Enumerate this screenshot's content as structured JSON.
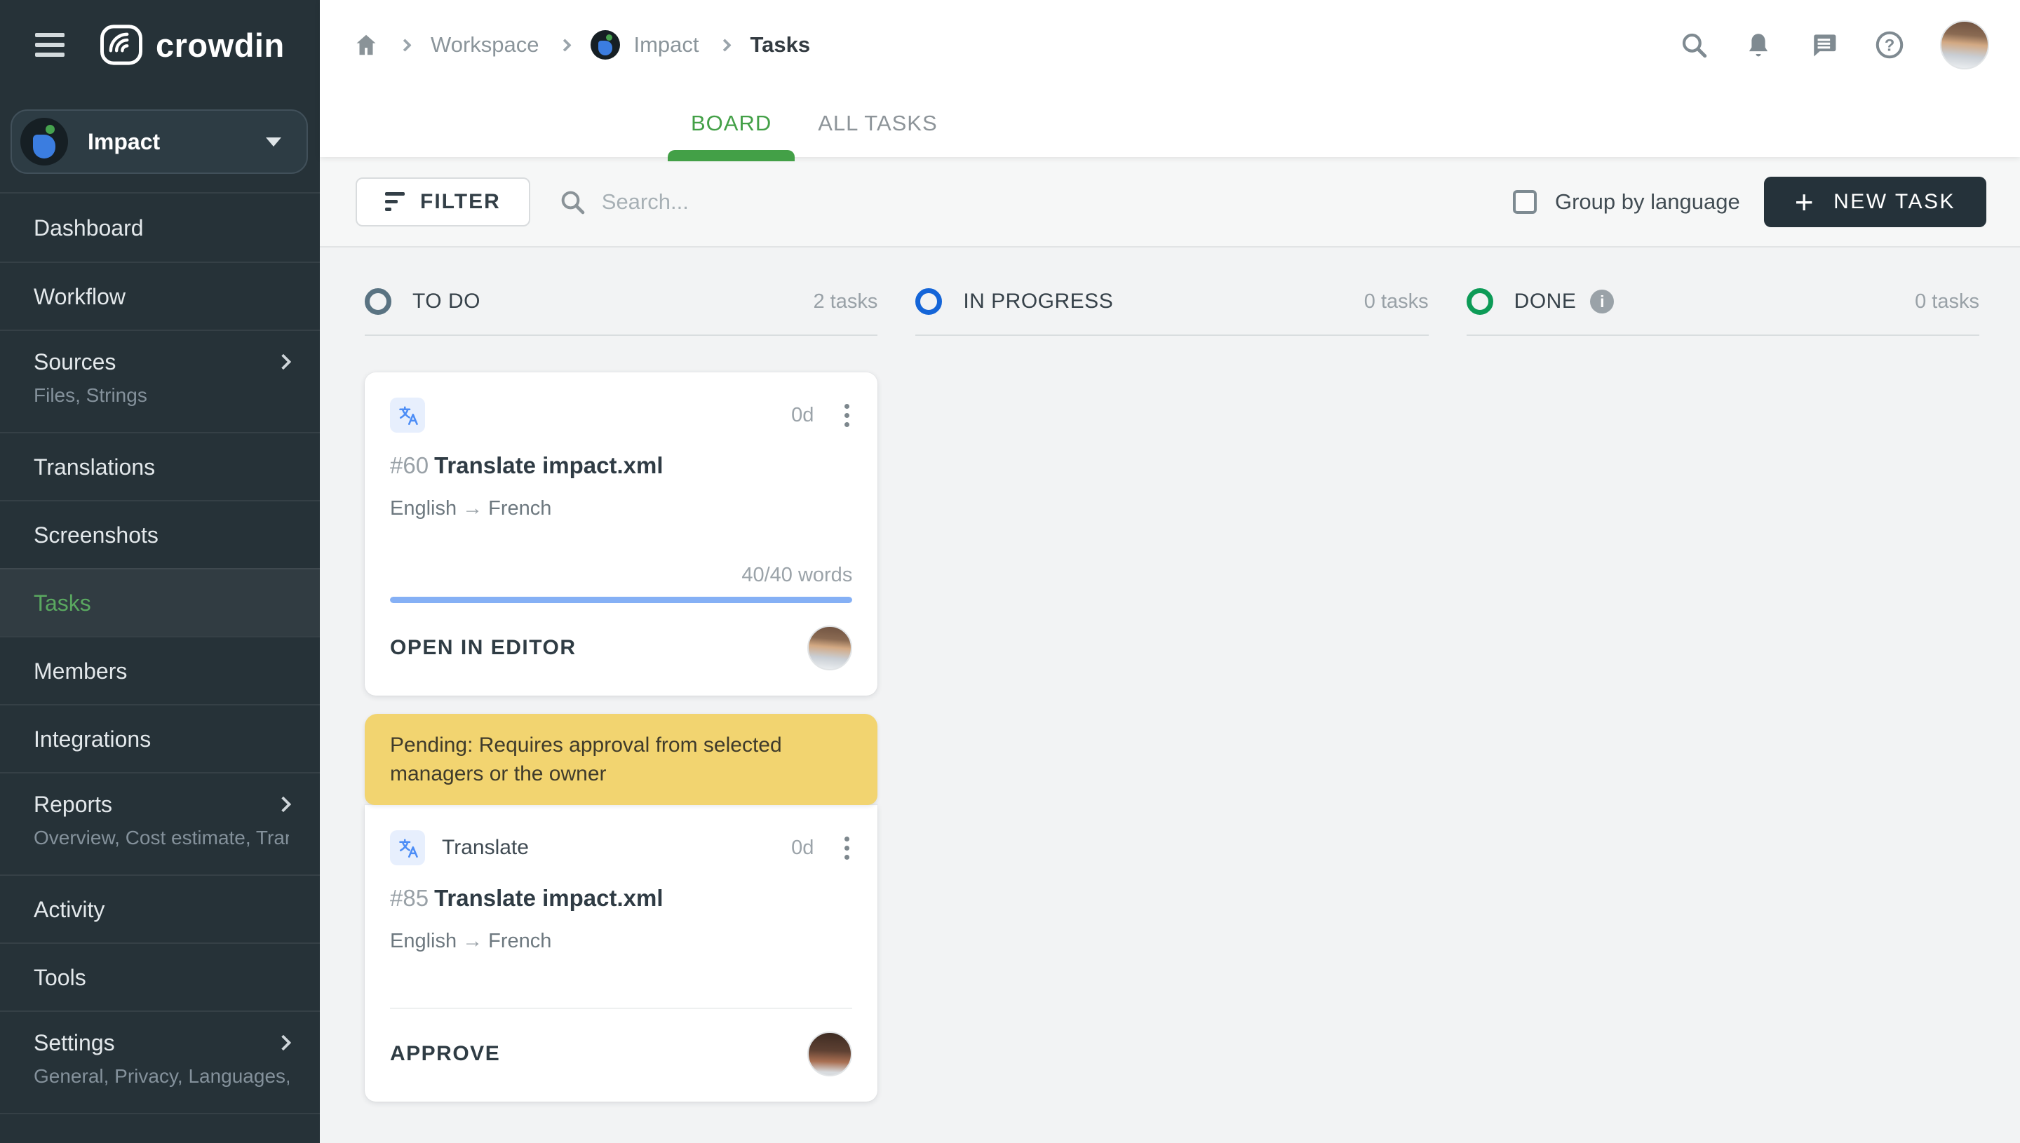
{
  "app": {
    "logo_text": "crowdin"
  },
  "topbar": {
    "breadcrumb": {
      "workspace": "Workspace",
      "project": "Impact",
      "current": "Tasks"
    }
  },
  "icons": {
    "help_glyph": "?",
    "info_glyph": "i",
    "plus_glyph": "+"
  },
  "sidebar": {
    "project_name": "Impact",
    "items": [
      {
        "label": "Dashboard"
      },
      {
        "label": "Workflow"
      },
      {
        "label": "Sources",
        "subtitle": "Files, Strings"
      },
      {
        "label": "Translations"
      },
      {
        "label": "Screenshots"
      },
      {
        "label": "Tasks"
      },
      {
        "label": "Members"
      },
      {
        "label": "Integrations"
      },
      {
        "label": "Reports",
        "subtitle": "Overview, Cost estimate, Transl…"
      },
      {
        "label": "Activity"
      },
      {
        "label": "Tools"
      },
      {
        "label": "Settings",
        "subtitle": "General, Privacy, Languages, Q…"
      }
    ]
  },
  "tabs": {
    "board": "BOARD",
    "all_tasks": "ALL TASKS"
  },
  "toolbar": {
    "filter": "FILTER",
    "search_placeholder": "Search...",
    "group_by": "Group by language",
    "new_task": "NEW TASK"
  },
  "board": {
    "columns": [
      {
        "title": "TO DO",
        "count": "2 tasks"
      },
      {
        "title": "IN PROGRESS",
        "count": "0 tasks"
      },
      {
        "title": "DONE",
        "count": "0 tasks"
      }
    ],
    "cards": [
      {
        "id": "#60",
        "title": "Translate impact.xml",
        "lang_from": "English",
        "lang_arrow": "→",
        "lang_to": "French",
        "duration": "0d",
        "words": "40/40 words",
        "progress_pct": 100,
        "action": "OPEN IN EDITOR"
      },
      {
        "banner": "Pending: Requires approval from selected managers or the owner",
        "type": "Translate",
        "id": "#85",
        "title": "Translate impact.xml",
        "lang_from": "English",
        "lang_arrow": "→",
        "lang_to": "French",
        "duration": "0d",
        "action": "APPROVE"
      }
    ]
  }
}
